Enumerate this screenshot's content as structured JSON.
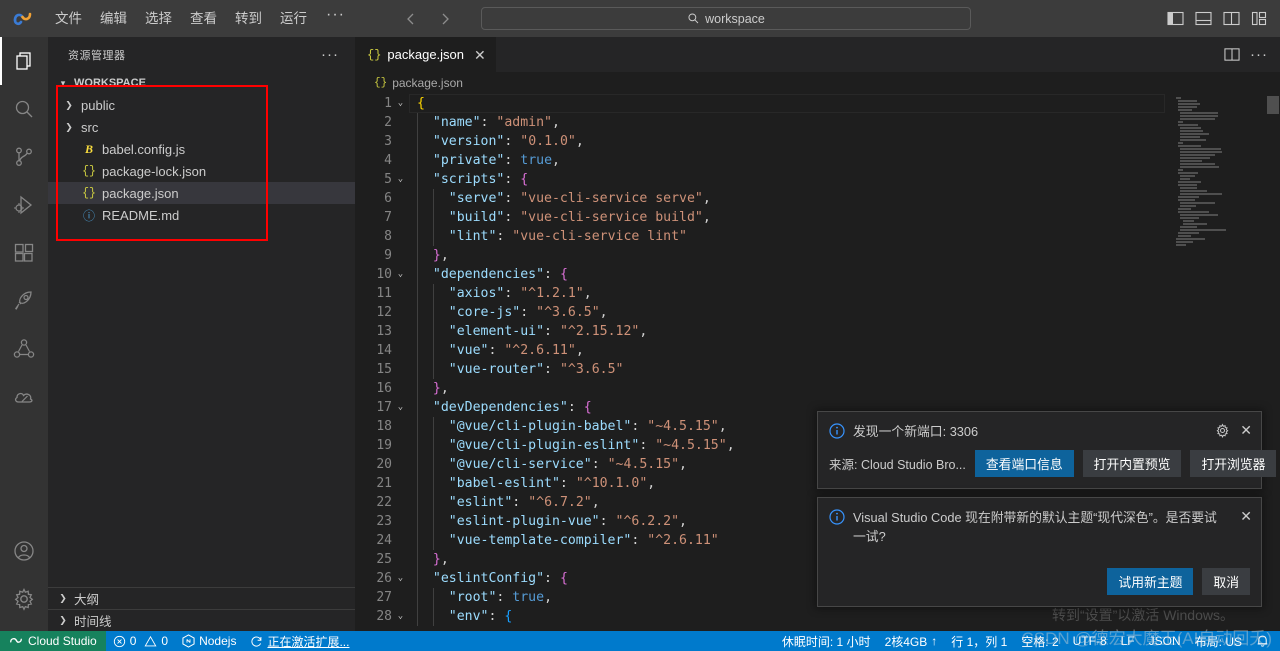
{
  "titlebar": {
    "logo_icon": "cloud-studio-logo",
    "menu": [
      "文件",
      "编辑",
      "选择",
      "查看",
      "转到",
      "运行"
    ],
    "menu_overflow": "···",
    "nav_back_icon": "arrow-left-icon",
    "nav_forward_icon": "arrow-forward-icon",
    "search_icon": "search-icon",
    "search_text": "workspace",
    "layout_icons": [
      "toggle-primary-sidebar-icon",
      "toggle-panel-icon",
      "toggle-secondary-sidebar-icon",
      "customize-layout-icon"
    ]
  },
  "activitybar": {
    "items": [
      {
        "name": "explorer-icon",
        "active": true
      },
      {
        "name": "search-icon",
        "active": false
      },
      {
        "name": "source-control-icon",
        "active": false
      },
      {
        "name": "run-and-debug-icon",
        "active": false
      },
      {
        "name": "extensions-icon",
        "active": false
      },
      {
        "name": "rocket-icon",
        "active": false
      },
      {
        "name": "share-icon",
        "active": false
      },
      {
        "name": "cloud-icon",
        "active": false
      }
    ],
    "bottom": [
      {
        "name": "account-icon"
      },
      {
        "name": "manage-settings-icon"
      }
    ]
  },
  "sidebar": {
    "title": "资源管理器",
    "more_actions": "···",
    "workspace_section": "WORKSPACE",
    "files": [
      {
        "label": "public",
        "icon": "folder-chevron-icon",
        "type": "folder",
        "selected": false
      },
      {
        "label": "src",
        "icon": "folder-chevron-icon",
        "type": "folder",
        "selected": false
      },
      {
        "label": "babel.config.js",
        "icon": "babel-file-icon",
        "type": "babel",
        "selected": false
      },
      {
        "label": "package-lock.json",
        "icon": "json-file-icon",
        "type": "json",
        "selected": false
      },
      {
        "label": "package.json",
        "icon": "json-file-icon",
        "type": "json",
        "selected": true
      },
      {
        "label": "README.md",
        "icon": "markdown-file-icon",
        "type": "md",
        "selected": false
      }
    ],
    "panels": [
      {
        "label": "大纲",
        "icon": "chevron-right-icon"
      },
      {
        "label": "时间线",
        "icon": "chevron-right-icon"
      }
    ],
    "annotation_color": "#ff0000"
  },
  "editor": {
    "tab": {
      "label": "package.json",
      "icon": "json-file-icon",
      "close_icon": "close-icon"
    },
    "tab_actions": [
      "split-editor-icon",
      "more-actions-icon"
    ],
    "breadcrumb": {
      "icon": "json-file-icon",
      "label": "package.json"
    },
    "cursor_line": 1,
    "code": [
      {
        "n": 1,
        "fold": "⌄",
        "tokens": [
          {
            "t": "{",
            "c": "b"
          }
        ]
      },
      {
        "n": 2,
        "fold": "",
        "tokens": [
          {
            "t": "  ",
            "c": "p"
          },
          {
            "t": "\"name\"",
            "c": "k"
          },
          {
            "t": ": ",
            "c": "p"
          },
          {
            "t": "\"admin\"",
            "c": "s"
          },
          {
            "t": ",",
            "c": "p"
          }
        ]
      },
      {
        "n": 3,
        "fold": "",
        "tokens": [
          {
            "t": "  ",
            "c": "p"
          },
          {
            "t": "\"version\"",
            "c": "k"
          },
          {
            "t": ": ",
            "c": "p"
          },
          {
            "t": "\"0.1.0\"",
            "c": "s"
          },
          {
            "t": ",",
            "c": "p"
          }
        ]
      },
      {
        "n": 4,
        "fold": "",
        "tokens": [
          {
            "t": "  ",
            "c": "p"
          },
          {
            "t": "\"private\"",
            "c": "k"
          },
          {
            "t": ": ",
            "c": "p"
          },
          {
            "t": "true",
            "c": "bool"
          },
          {
            "t": ",",
            "c": "p"
          }
        ]
      },
      {
        "n": 5,
        "fold": "⌄",
        "tokens": [
          {
            "t": "  ",
            "c": "p"
          },
          {
            "t": "\"scripts\"",
            "c": "k"
          },
          {
            "t": ": ",
            "c": "p"
          },
          {
            "t": "{",
            "c": "b2"
          }
        ]
      },
      {
        "n": 6,
        "fold": "",
        "tokens": [
          {
            "t": "    ",
            "c": "p"
          },
          {
            "t": "\"serve\"",
            "c": "k"
          },
          {
            "t": ": ",
            "c": "p"
          },
          {
            "t": "\"vue-cli-service serve\"",
            "c": "s"
          },
          {
            "t": ",",
            "c": "p"
          }
        ]
      },
      {
        "n": 7,
        "fold": "",
        "tokens": [
          {
            "t": "    ",
            "c": "p"
          },
          {
            "t": "\"build\"",
            "c": "k"
          },
          {
            "t": ": ",
            "c": "p"
          },
          {
            "t": "\"vue-cli-service build\"",
            "c": "s"
          },
          {
            "t": ",",
            "c": "p"
          }
        ]
      },
      {
        "n": 8,
        "fold": "",
        "tokens": [
          {
            "t": "    ",
            "c": "p"
          },
          {
            "t": "\"lint\"",
            "c": "k"
          },
          {
            "t": ": ",
            "c": "p"
          },
          {
            "t": "\"vue-cli-service lint\"",
            "c": "s"
          }
        ]
      },
      {
        "n": 9,
        "fold": "",
        "tokens": [
          {
            "t": "  ",
            "c": "p"
          },
          {
            "t": "}",
            "c": "b2"
          },
          {
            "t": ",",
            "c": "p"
          }
        ]
      },
      {
        "n": 10,
        "fold": "⌄",
        "tokens": [
          {
            "t": "  ",
            "c": "p"
          },
          {
            "t": "\"dependencies\"",
            "c": "k"
          },
          {
            "t": ": ",
            "c": "p"
          },
          {
            "t": "{",
            "c": "b2"
          }
        ]
      },
      {
        "n": 11,
        "fold": "",
        "tokens": [
          {
            "t": "    ",
            "c": "p"
          },
          {
            "t": "\"axios\"",
            "c": "k"
          },
          {
            "t": ": ",
            "c": "p"
          },
          {
            "t": "\"^1.2.1\"",
            "c": "s"
          },
          {
            "t": ",",
            "c": "p"
          }
        ]
      },
      {
        "n": 12,
        "fold": "",
        "tokens": [
          {
            "t": "    ",
            "c": "p"
          },
          {
            "t": "\"core-js\"",
            "c": "k"
          },
          {
            "t": ": ",
            "c": "p"
          },
          {
            "t": "\"^3.6.5\"",
            "c": "s"
          },
          {
            "t": ",",
            "c": "p"
          }
        ]
      },
      {
        "n": 13,
        "fold": "",
        "tokens": [
          {
            "t": "    ",
            "c": "p"
          },
          {
            "t": "\"element-ui\"",
            "c": "k"
          },
          {
            "t": ": ",
            "c": "p"
          },
          {
            "t": "\"^2.15.12\"",
            "c": "s"
          },
          {
            "t": ",",
            "c": "p"
          }
        ]
      },
      {
        "n": 14,
        "fold": "",
        "tokens": [
          {
            "t": "    ",
            "c": "p"
          },
          {
            "t": "\"vue\"",
            "c": "k"
          },
          {
            "t": ": ",
            "c": "p"
          },
          {
            "t": "\"^2.6.11\"",
            "c": "s"
          },
          {
            "t": ",",
            "c": "p"
          }
        ]
      },
      {
        "n": 15,
        "fold": "",
        "tokens": [
          {
            "t": "    ",
            "c": "p"
          },
          {
            "t": "\"vue-router\"",
            "c": "k"
          },
          {
            "t": ": ",
            "c": "p"
          },
          {
            "t": "\"^3.6.5\"",
            "c": "s"
          }
        ]
      },
      {
        "n": 16,
        "fold": "",
        "tokens": [
          {
            "t": "  ",
            "c": "p"
          },
          {
            "t": "}",
            "c": "b2"
          },
          {
            "t": ",",
            "c": "p"
          }
        ]
      },
      {
        "n": 17,
        "fold": "⌄",
        "tokens": [
          {
            "t": "  ",
            "c": "p"
          },
          {
            "t": "\"devDependencies\"",
            "c": "k"
          },
          {
            "t": ": ",
            "c": "p"
          },
          {
            "t": "{",
            "c": "b2"
          }
        ]
      },
      {
        "n": 18,
        "fold": "",
        "tokens": [
          {
            "t": "    ",
            "c": "p"
          },
          {
            "t": "\"@vue/cli-plugin-babel\"",
            "c": "k"
          },
          {
            "t": ": ",
            "c": "p"
          },
          {
            "t": "\"~4.5.15\"",
            "c": "s"
          },
          {
            "t": ",",
            "c": "p"
          }
        ]
      },
      {
        "n": 19,
        "fold": "",
        "tokens": [
          {
            "t": "    ",
            "c": "p"
          },
          {
            "t": "\"@vue/cli-plugin-eslint\"",
            "c": "k"
          },
          {
            "t": ": ",
            "c": "p"
          },
          {
            "t": "\"~4.5.15\"",
            "c": "s"
          },
          {
            "t": ",",
            "c": "p"
          }
        ]
      },
      {
        "n": 20,
        "fold": "",
        "tokens": [
          {
            "t": "    ",
            "c": "p"
          },
          {
            "t": "\"@vue/cli-service\"",
            "c": "k"
          },
          {
            "t": ": ",
            "c": "p"
          },
          {
            "t": "\"~4.5.15\"",
            "c": "s"
          },
          {
            "t": ",",
            "c": "p"
          }
        ]
      },
      {
        "n": 21,
        "fold": "",
        "tokens": [
          {
            "t": "    ",
            "c": "p"
          },
          {
            "t": "\"babel-eslint\"",
            "c": "k"
          },
          {
            "t": ": ",
            "c": "p"
          },
          {
            "t": "\"^10.1.0\"",
            "c": "s"
          },
          {
            "t": ",",
            "c": "p"
          }
        ]
      },
      {
        "n": 22,
        "fold": "",
        "tokens": [
          {
            "t": "    ",
            "c": "p"
          },
          {
            "t": "\"eslint\"",
            "c": "k"
          },
          {
            "t": ": ",
            "c": "p"
          },
          {
            "t": "\"^6.7.2\"",
            "c": "s"
          },
          {
            "t": ",",
            "c": "p"
          }
        ]
      },
      {
        "n": 23,
        "fold": "",
        "tokens": [
          {
            "t": "    ",
            "c": "p"
          },
          {
            "t": "\"eslint-plugin-vue\"",
            "c": "k"
          },
          {
            "t": ": ",
            "c": "p"
          },
          {
            "t": "\"^6.2.2\"",
            "c": "s"
          },
          {
            "t": ",",
            "c": "p"
          }
        ]
      },
      {
        "n": 24,
        "fold": "",
        "tokens": [
          {
            "t": "    ",
            "c": "p"
          },
          {
            "t": "\"vue-template-compiler\"",
            "c": "k"
          },
          {
            "t": ": ",
            "c": "p"
          },
          {
            "t": "\"^2.6.11\"",
            "c": "s"
          }
        ]
      },
      {
        "n": 25,
        "fold": "",
        "tokens": [
          {
            "t": "  ",
            "c": "p"
          },
          {
            "t": "}",
            "c": "b2"
          },
          {
            "t": ",",
            "c": "p"
          }
        ]
      },
      {
        "n": 26,
        "fold": "⌄",
        "tokens": [
          {
            "t": "  ",
            "c": "p"
          },
          {
            "t": "\"eslintConfig\"",
            "c": "k"
          },
          {
            "t": ": ",
            "c": "p"
          },
          {
            "t": "{",
            "c": "b2"
          }
        ]
      },
      {
        "n": 27,
        "fold": "",
        "tokens": [
          {
            "t": "    ",
            "c": "p"
          },
          {
            "t": "\"root\"",
            "c": "k"
          },
          {
            "t": ": ",
            "c": "p"
          },
          {
            "t": "true",
            "c": "bool"
          },
          {
            "t": ",",
            "c": "p"
          }
        ]
      },
      {
        "n": 28,
        "fold": "⌄",
        "tokens": [
          {
            "t": "    ",
            "c": "p"
          },
          {
            "t": "\"env\"",
            "c": "k"
          },
          {
            "t": ": ",
            "c": "p"
          },
          {
            "t": "{",
            "c": "b3"
          }
        ]
      }
    ]
  },
  "notifications": [
    {
      "icon": "info-icon",
      "message": "发现一个新端口: 3306",
      "source": "来源: Cloud Studio Bro...",
      "gear_icon": "gear-icon",
      "close_icon": "close-icon",
      "buttons": [
        {
          "label": "查看端口信息",
          "primary": true
        },
        {
          "label": "打开内置预览",
          "primary": false
        },
        {
          "label": "打开浏览器",
          "primary": false
        }
      ]
    },
    {
      "icon": "info-icon",
      "message": "Visual Studio Code 现在附带新的默认主题“现代深色”。是否要试一试?",
      "close_icon": "close-icon",
      "buttons": [
        {
          "label": "试用新主题",
          "primary": true
        },
        {
          "label": "取消",
          "primary": false
        }
      ]
    }
  ],
  "watermark": {
    "activate_line1": "激活 Windows",
    "activate_line2": "转到“设置”以激活 Windows。",
    "csdn": "CSDN @德宏大魔王(AI自动回夭)"
  },
  "statusbar": {
    "remote": {
      "icon": "remote-icon",
      "label": "Cloud Studio"
    },
    "left_items": [
      {
        "icon": "error-icon",
        "label": "0",
        "second_icon": "warning-icon",
        "second_label": "0"
      },
      {
        "icon": "nodejs-icon",
        "label": "Nodejs"
      },
      {
        "icon": "sync-icon",
        "label": "正在激活扩展...",
        "underline": true
      }
    ],
    "right_items": [
      {
        "label": "休眠时间: 1 小时"
      },
      {
        "label": "2核4GB",
        "icon": "arrow-up-icon"
      },
      {
        "label": "行 1，列 1"
      },
      {
        "label": "空格: 2"
      },
      {
        "label": "UTF-8"
      },
      {
        "label": "LF"
      },
      {
        "label": "JSON"
      },
      {
        "label": "布局: US"
      },
      {
        "icon": "bell-icon",
        "label": ""
      }
    ]
  }
}
